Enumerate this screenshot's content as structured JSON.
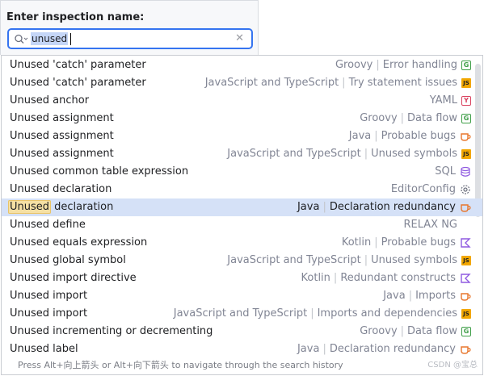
{
  "popup": {
    "title": "Enter inspection name:",
    "search_value": "unused"
  },
  "list": {
    "items": [
      {
        "name": "Unused 'catch' parameter",
        "path": [
          "Groovy",
          "Error handling"
        ],
        "icon": "groovy-icon",
        "selected": false
      },
      {
        "name": "Unused 'catch' parameter",
        "path": [
          "JavaScript and TypeScript",
          "Try statement issues"
        ],
        "icon": "javascript-icon",
        "selected": false
      },
      {
        "name": "Unused anchor",
        "path": [
          "YAML"
        ],
        "icon": "yaml-icon",
        "selected": false
      },
      {
        "name": "Unused assignment",
        "path": [
          "Groovy",
          "Data flow"
        ],
        "icon": "groovy-icon",
        "selected": false
      },
      {
        "name": "Unused assignment",
        "path": [
          "Java",
          "Probable bugs"
        ],
        "icon": "java-icon",
        "selected": false
      },
      {
        "name": "Unused assignment",
        "path": [
          "JavaScript and TypeScript",
          "Unused symbols"
        ],
        "icon": "javascript-icon",
        "selected": false
      },
      {
        "name": "Unused common table expression",
        "path": [
          "SQL"
        ],
        "icon": "sql-database-icon",
        "selected": false
      },
      {
        "name": "Unused declaration",
        "path": [
          "EditorConfig"
        ],
        "icon": "editorconfig-gear-icon",
        "selected": false
      },
      {
        "name": "Unused declaration",
        "name_highlight": "Unused",
        "name_rest": " declaration",
        "path": [
          "Java",
          "Declaration redundancy"
        ],
        "icon": "java-icon",
        "selected": true
      },
      {
        "name": "Unused define",
        "path": [
          "RELAX NG"
        ],
        "icon": "",
        "selected": false
      },
      {
        "name": "Unused equals expression",
        "path": [
          "Kotlin",
          "Probable bugs"
        ],
        "icon": "kotlin-icon",
        "selected": false
      },
      {
        "name": "Unused global symbol",
        "path": [
          "JavaScript and TypeScript",
          "Unused symbols"
        ],
        "icon": "javascript-icon",
        "selected": false
      },
      {
        "name": "Unused import directive",
        "path": [
          "Kotlin",
          "Redundant constructs"
        ],
        "icon": "kotlin-icon",
        "selected": false
      },
      {
        "name": "Unused import",
        "path": [
          "Java",
          "Imports"
        ],
        "icon": "java-icon",
        "selected": false
      },
      {
        "name": "Unused import",
        "path": [
          "JavaScript and TypeScript",
          "Imports and dependencies"
        ],
        "icon": "javascript-icon",
        "selected": false
      },
      {
        "name": "Unused incrementing or decrementing",
        "path": [
          "Groovy",
          "Data flow"
        ],
        "icon": "groovy-icon",
        "selected": false
      },
      {
        "name": "Unused label",
        "path": [
          "Java",
          "Declaration redundancy"
        ],
        "icon": "java-icon",
        "selected": false
      }
    ]
  },
  "footer": {
    "hint": "Press Alt+向上箭头 or Alt+向下箭头 to navigate through the search history",
    "watermark": "CSDN @宝总"
  },
  "colors": {
    "accent": "#3574f0",
    "selection": "#d5e1f7",
    "groovy": "#3e9e47",
    "javascript": "#f2a700",
    "java": "#e8762c",
    "yaml": "#d9425f",
    "kotlin": "#8f5ae0"
  }
}
